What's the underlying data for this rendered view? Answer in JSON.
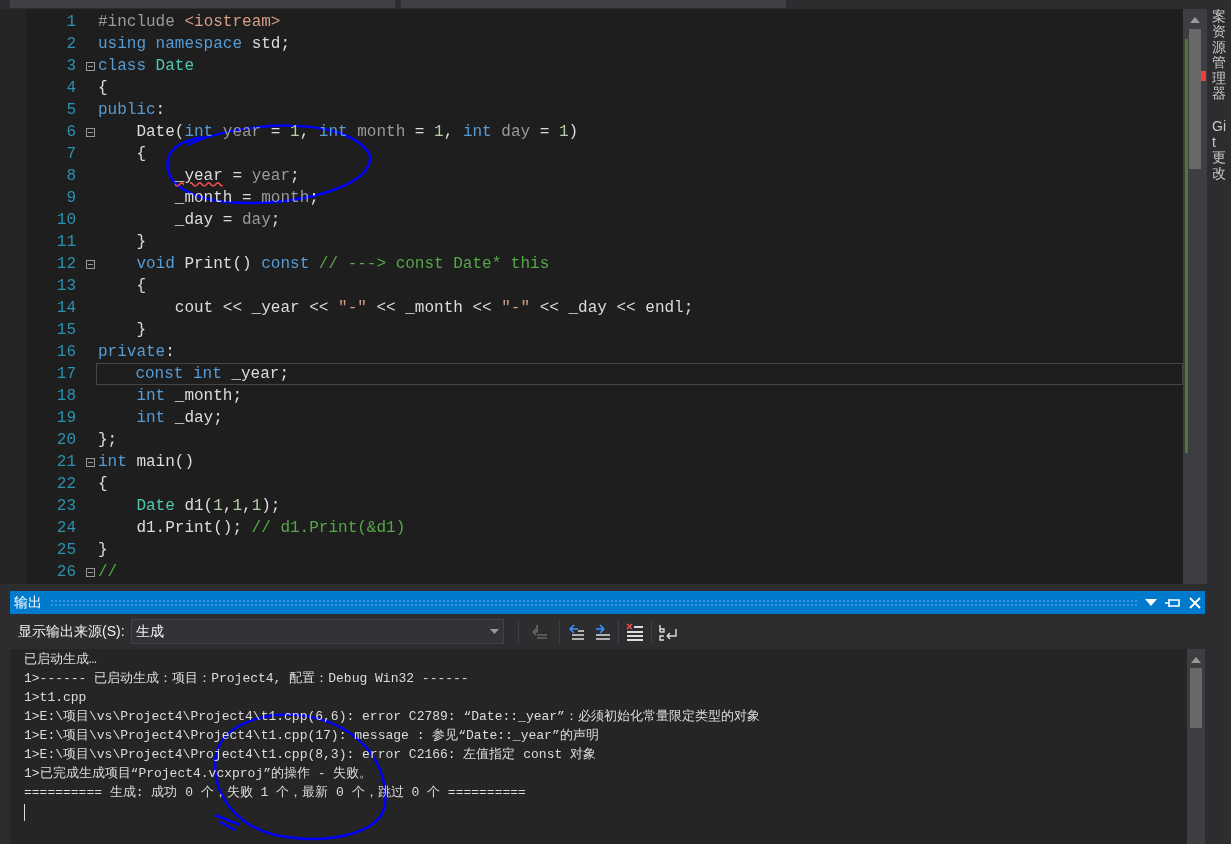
{
  "editor": {
    "lines": [
      {
        "number": "1",
        "kind": "top",
        "fold": false,
        "current": false,
        "tokens": [
          {
            "kind": "pre",
            "text": "#include "
          },
          {
            "kind": "str",
            "text": "<iostream>"
          }
        ]
      },
      {
        "number": "2",
        "kind": "top",
        "fold": false,
        "current": false,
        "tokens": [
          {
            "kind": "kw",
            "text": "using namespace "
          },
          {
            "kind": "plain",
            "text": "std;"
          }
        ]
      },
      {
        "number": "3",
        "kind": "top",
        "fold": true,
        "current": false,
        "tokens": [
          {
            "kind": "kw",
            "text": "class "
          },
          {
            "kind": "type",
            "text": "Date"
          }
        ]
      },
      {
        "number": "4",
        "kind": "top",
        "fold": false,
        "current": false,
        "tokens": [
          {
            "kind": "plain",
            "text": "{"
          }
        ]
      },
      {
        "number": "5",
        "kind": "top",
        "fold": false,
        "current": false,
        "tokens": [
          {
            "kind": "kw",
            "text": "public"
          },
          {
            "kind": "plain",
            "text": ":"
          }
        ]
      },
      {
        "number": "6",
        "kind": "member",
        "fold": true,
        "current": false,
        "tokens": [
          {
            "kind": "plain",
            "text": "Date("
          },
          {
            "kind": "kw",
            "text": "int "
          },
          {
            "kind": "param",
            "text": "year"
          },
          {
            "kind": "plain",
            "text": " = "
          },
          {
            "kind": "num",
            "text": "1"
          },
          {
            "kind": "plain",
            "text": ", "
          },
          {
            "kind": "kw",
            "text": "int "
          },
          {
            "kind": "param",
            "text": "month"
          },
          {
            "kind": "plain",
            "text": " = "
          },
          {
            "kind": "num",
            "text": "1"
          },
          {
            "kind": "plain",
            "text": ", "
          },
          {
            "kind": "kw",
            "text": "int "
          },
          {
            "kind": "param",
            "text": "day"
          },
          {
            "kind": "plain",
            "text": " = "
          },
          {
            "kind": "num",
            "text": "1"
          },
          {
            "kind": "plain",
            "text": ")"
          }
        ]
      },
      {
        "number": "7",
        "kind": "member",
        "fold": false,
        "current": false,
        "tokens": [
          {
            "kind": "plain",
            "text": "{"
          }
        ]
      },
      {
        "number": "8",
        "kind": "body",
        "fold": false,
        "current": false,
        "tokens": [
          {
            "kind": "error",
            "text": "_year"
          },
          {
            "kind": "plain",
            "text": " = "
          },
          {
            "kind": "param",
            "text": "year"
          },
          {
            "kind": "plain",
            "text": ";"
          }
        ]
      },
      {
        "number": "9",
        "kind": "body",
        "fold": false,
        "current": false,
        "tokens": [
          {
            "kind": "plain",
            "text": "_month = "
          },
          {
            "kind": "param",
            "text": "month"
          },
          {
            "kind": "plain",
            "text": ";"
          }
        ]
      },
      {
        "number": "10",
        "kind": "body",
        "fold": false,
        "current": false,
        "tokens": [
          {
            "kind": "plain",
            "text": "_day = "
          },
          {
            "kind": "param",
            "text": "day"
          },
          {
            "kind": "plain",
            "text": ";"
          }
        ]
      },
      {
        "number": "11",
        "kind": "member",
        "fold": false,
        "current": false,
        "tokens": [
          {
            "kind": "plain",
            "text": "}"
          }
        ]
      },
      {
        "number": "12",
        "kind": "member",
        "fold": true,
        "current": false,
        "tokens": [
          {
            "kind": "kw",
            "text": "void "
          },
          {
            "kind": "plain",
            "text": "Print() "
          },
          {
            "kind": "kw",
            "text": "const "
          },
          {
            "kind": "cmt",
            "text": "// ---> const Date* this"
          }
        ]
      },
      {
        "number": "13",
        "kind": "member",
        "fold": false,
        "current": false,
        "tokens": [
          {
            "kind": "plain",
            "text": "{"
          }
        ]
      },
      {
        "number": "14",
        "kind": "body",
        "fold": false,
        "current": false,
        "tokens": [
          {
            "kind": "plain",
            "text": "cout << _year << "
          },
          {
            "kind": "str",
            "text": "\"-\""
          },
          {
            "kind": "plain",
            "text": " << _month << "
          },
          {
            "kind": "str",
            "text": "\"-\""
          },
          {
            "kind": "plain",
            "text": " << _day << endl;"
          }
        ]
      },
      {
        "number": "15",
        "kind": "member",
        "fold": false,
        "current": false,
        "tokens": [
          {
            "kind": "plain",
            "text": "}"
          }
        ]
      },
      {
        "number": "16",
        "kind": "top",
        "fold": false,
        "current": false,
        "tokens": [
          {
            "kind": "kw",
            "text": "private"
          },
          {
            "kind": "plain",
            "text": ":"
          }
        ]
      },
      {
        "number": "17",
        "kind": "member",
        "fold": false,
        "current": true,
        "tokens": [
          {
            "kind": "kw",
            "text": "const int "
          },
          {
            "kind": "plain",
            "text": "_year;"
          }
        ]
      },
      {
        "number": "18",
        "kind": "member",
        "fold": false,
        "current": false,
        "tokens": [
          {
            "kind": "kw",
            "text": "int "
          },
          {
            "kind": "plain",
            "text": "_month;"
          }
        ]
      },
      {
        "number": "19",
        "kind": "member",
        "fold": false,
        "current": false,
        "tokens": [
          {
            "kind": "kw",
            "text": "int "
          },
          {
            "kind": "plain",
            "text": "_day;"
          }
        ]
      },
      {
        "number": "20",
        "kind": "top",
        "fold": false,
        "current": false,
        "tokens": [
          {
            "kind": "plain",
            "text": "};"
          }
        ]
      },
      {
        "number": "21",
        "kind": "top",
        "fold": true,
        "current": false,
        "tokens": [
          {
            "kind": "kw",
            "text": "int "
          },
          {
            "kind": "plain",
            "text": "main()"
          }
        ]
      },
      {
        "number": "22",
        "kind": "top",
        "fold": false,
        "current": false,
        "tokens": [
          {
            "kind": "plain",
            "text": "{"
          }
        ]
      },
      {
        "number": "23",
        "kind": "member",
        "fold": false,
        "current": false,
        "tokens": [
          {
            "kind": "type",
            "text": "Date "
          },
          {
            "kind": "plain",
            "text": "d1("
          },
          {
            "kind": "num",
            "text": "1"
          },
          {
            "kind": "plain",
            "text": ","
          },
          {
            "kind": "num",
            "text": "1"
          },
          {
            "kind": "plain",
            "text": ","
          },
          {
            "kind": "num",
            "text": "1"
          },
          {
            "kind": "plain",
            "text": ");"
          }
        ]
      },
      {
        "number": "24",
        "kind": "member",
        "fold": false,
        "current": false,
        "tokens": [
          {
            "kind": "plain",
            "text": "d1.Print(); "
          },
          {
            "kind": "cmt",
            "text": "// d1.Print(&d1)"
          }
        ]
      },
      {
        "number": "25",
        "kind": "top",
        "fold": false,
        "current": false,
        "tokens": [
          {
            "kind": "plain",
            "text": "}"
          }
        ]
      },
      {
        "number": "26",
        "kind": "top",
        "fold": true,
        "current": false,
        "tokens": [
          {
            "kind": "cmt",
            "text": "//"
          }
        ]
      }
    ]
  },
  "side_tabs": [
    "案资源管理器",
    "Git 更改"
  ],
  "output": {
    "title": "输出",
    "source_label": "显示输出来源(S):",
    "source_value": "生成",
    "lines": [
      "已启动生成…",
      "1>------ 已启动生成：项目：Project4, 配置：Debug Win32 ------",
      "1>t1.cpp",
      "1>E:\\项目\\vs\\Project4\\Project4\\t1.cpp(6,6): error C2789: “Date::_year”：必须初始化常量限定类型的对象",
      "1>E:\\项目\\vs\\Project4\\Project4\\t1.cpp(17): message : 参见“Date::_year”的声明",
      "1>E:\\项目\\vs\\Project4\\Project4\\t1.cpp(8,3): error C2166: 左值指定 const 对象",
      "1>已完成生成项目“Project4.vcxproj”的操作 - 失败。",
      "========== 生成: 成功 0 个，失败 1 个，最新 0 个，跳过 0 个 =========="
    ]
  }
}
